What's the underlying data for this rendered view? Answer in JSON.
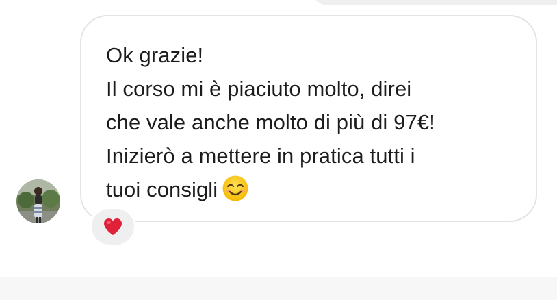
{
  "message": {
    "lines": [
      "Ok grazie!",
      "Il corso mi è piaciuto molto, direi",
      "che vale anche molto di più di 97€!",
      "Inizierò a mettere in pratica tutti i",
      "tuoi consigli"
    ],
    "emoji": "smiling-face-with-smiling-eyes",
    "reaction": "red-heart"
  },
  "colors": {
    "bubble_border": "#e3e3e3",
    "text": "#1c1c1c",
    "reaction_bg": "#efefef",
    "heart": "#e0213a"
  }
}
